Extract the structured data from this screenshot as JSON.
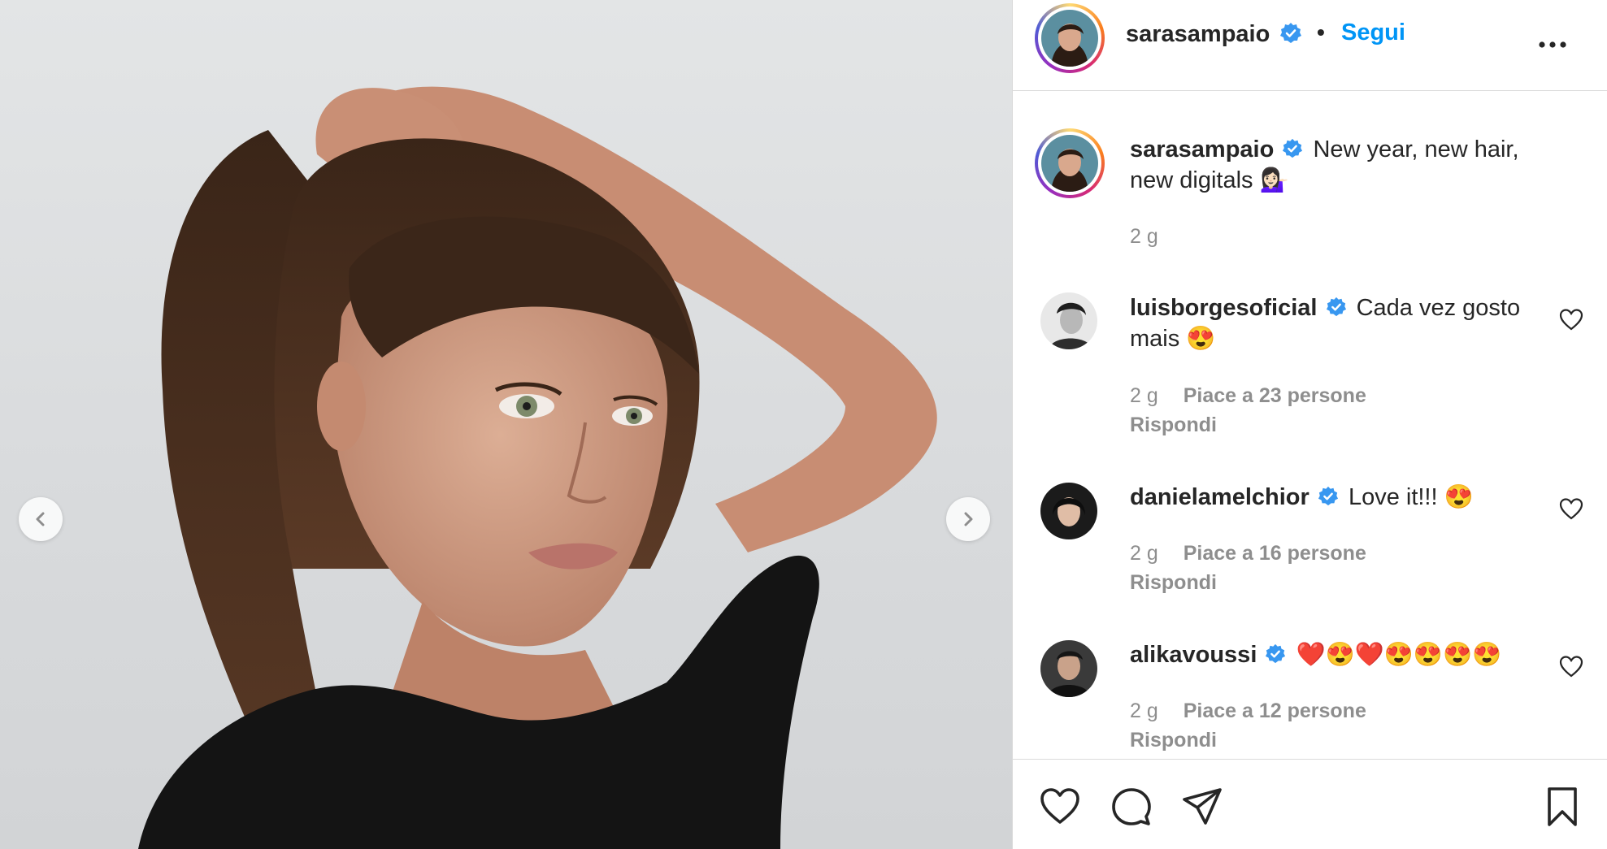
{
  "header": {
    "username": "sarasampaio",
    "separator": "•",
    "follow_label": "Segui",
    "more_label": "•••"
  },
  "caption": {
    "username": "sarasampaio",
    "text": "New year, new hair, new digitals 💁🏻‍♀️",
    "time": "2 g"
  },
  "comments": [
    {
      "username": "luisborgesoficial",
      "text": "Cada vez gosto mais 😍",
      "time": "2 g",
      "likes": "Piace a 23 persone",
      "reply": "Rispondi"
    },
    {
      "username": "danielamelchior",
      "text": "Love it!!! 😍",
      "time": "2 g",
      "likes": "Piace a 16 persone",
      "reply": "Rispondi"
    },
    {
      "username": "alikavoussi",
      "text": "❤️😍❤️😍😍😍😍",
      "time": "2 g",
      "likes": "Piace a 12 persone",
      "reply": "Rispondi"
    }
  ],
  "icons": {
    "prev": "chevron-left-icon",
    "next": "chevron-right-icon",
    "like": "heart-icon",
    "comment": "comment-icon",
    "share": "paper-plane-icon",
    "save": "bookmark-icon",
    "verified": "verified-badge-icon"
  },
  "colors": {
    "accent": "#0095f6",
    "verified": "#3897f0",
    "text": "#262626",
    "muted": "#8e8e8e"
  }
}
